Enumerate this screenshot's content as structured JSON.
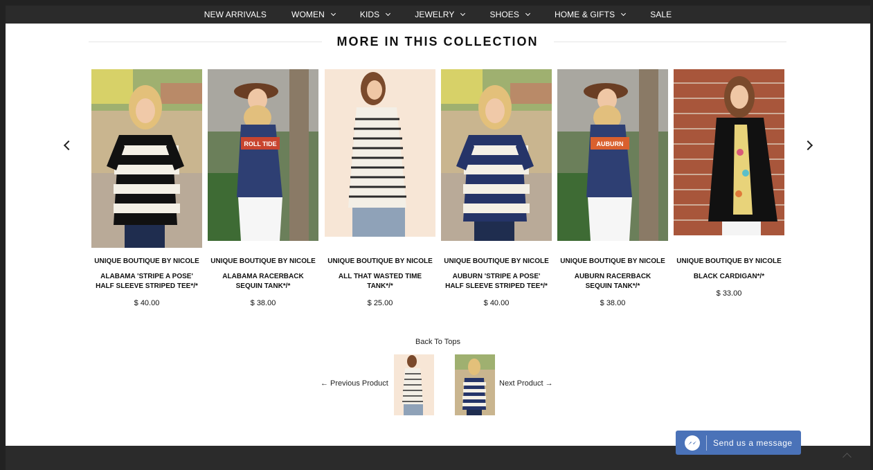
{
  "nav": {
    "items": [
      {
        "label": "NEW ARRIVALS",
        "dropdown": false
      },
      {
        "label": "WOMEN",
        "dropdown": true
      },
      {
        "label": "KIDS",
        "dropdown": true
      },
      {
        "label": "JEWELRY",
        "dropdown": true
      },
      {
        "label": "SHOES",
        "dropdown": true
      },
      {
        "label": "HOME & GIFTS",
        "dropdown": true
      },
      {
        "label": "SALE",
        "dropdown": false
      }
    ]
  },
  "collection": {
    "title": "MORE IN THIS COLLECTION",
    "products": [
      {
        "brand": "UNIQUE BOUTIQUE BY NICOLE",
        "name_line1": "ALABAMA 'STRIPE A POSE'",
        "name_line2": "HALF SLEEVE STRIPED TEE*/*",
        "price": "$ 40.00"
      },
      {
        "brand": "UNIQUE BOUTIQUE BY NICOLE",
        "name_line1": "ALABAMA RACERBACK",
        "name_line2": "SEQUIN TANK*/*",
        "price": "$ 38.00",
        "shirt_text": "ROLL TIDE"
      },
      {
        "brand": "UNIQUE BOUTIQUE BY NICOLE",
        "name_line1": "ALL THAT WASTED TIME",
        "name_line2": "TANK*/*",
        "price": "$ 25.00"
      },
      {
        "brand": "UNIQUE BOUTIQUE BY NICOLE",
        "name_line1": "AUBURN 'STRIPE A POSE'",
        "name_line2": "HALF SLEEVE STRIPED TEE*/*",
        "price": "$ 40.00"
      },
      {
        "brand": "UNIQUE BOUTIQUE BY NICOLE",
        "name_line1": "AUBURN RACERBACK",
        "name_line2": "SEQUIN TANK*/*",
        "price": "$ 38.00",
        "shirt_text": "AUBURN"
      },
      {
        "brand": "UNIQUE BOUTIQUE BY NICOLE",
        "name_line1": "BLACK CARDIGAN*/*",
        "name_line2": "",
        "price": "$ 33.00"
      }
    ]
  },
  "pager": {
    "back_label": "Back To Tops",
    "prev_label": "← Previous Product",
    "next_label": "Next Product →"
  },
  "messenger": {
    "label": "Send us a message",
    "color": "#4a72b8"
  },
  "icons": {
    "prev_arrow": "chevron-left-icon",
    "next_arrow": "chevron-right-icon",
    "messenger": "messenger-icon",
    "scroll_top": "chevron-up-icon"
  }
}
